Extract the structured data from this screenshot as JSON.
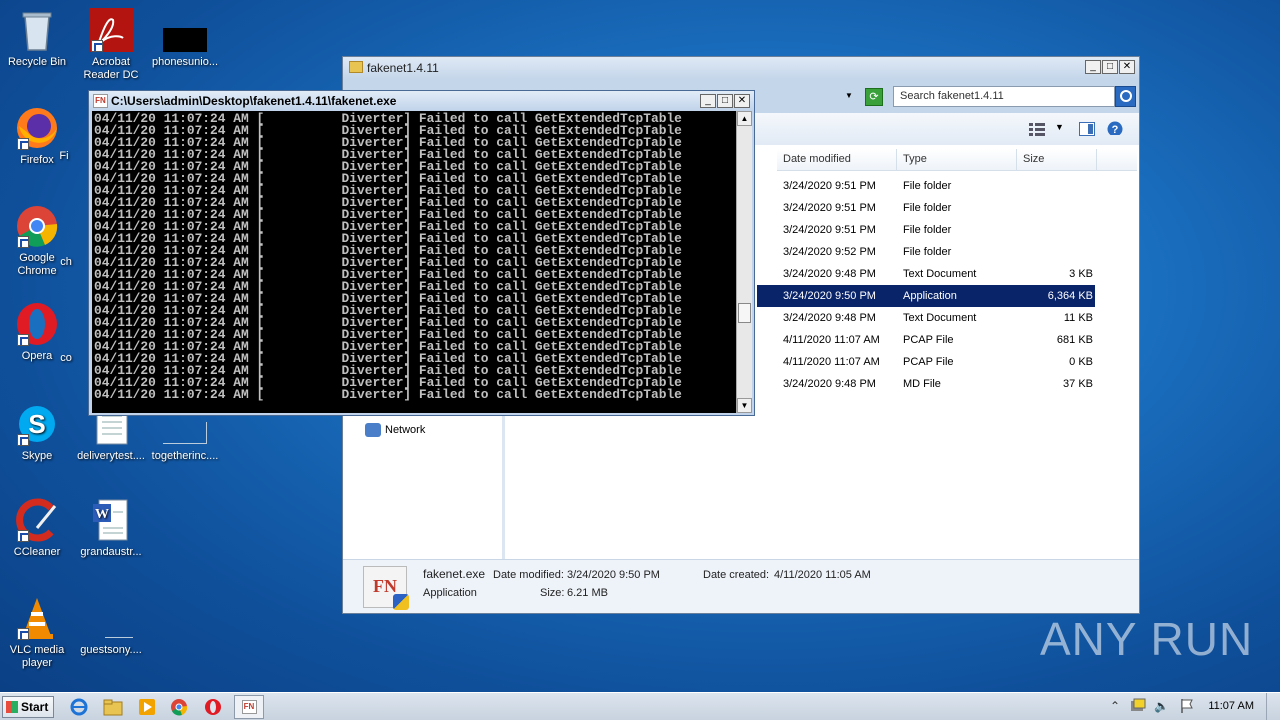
{
  "desktop_icons": [
    {
      "label": "Recycle Bin",
      "icon": "recycle-bin-icon"
    },
    {
      "label": "Acrobat Reader DC",
      "icon": "acrobat-icon"
    },
    {
      "label": "phonesunio...",
      "icon": "file-icon"
    },
    {
      "label": "Firefox",
      "icon": "firefox-icon"
    },
    {
      "label": "Fi",
      "icon": "file-icon"
    },
    {
      "label": "Google Chrome",
      "icon": "chrome-icon"
    },
    {
      "label": "ch",
      "icon": "file-icon"
    },
    {
      "label": "Opera",
      "icon": "opera-icon"
    },
    {
      "label": "co",
      "icon": "file-icon"
    },
    {
      "label": "Skype",
      "icon": "skype-icon"
    },
    {
      "label": "deliverytest....",
      "icon": "word-doc-icon"
    },
    {
      "label": "togetherinc....",
      "icon": "file-icon"
    },
    {
      "label": "CCleaner",
      "icon": "ccleaner-icon"
    },
    {
      "label": "grandaustr...",
      "icon": "word-doc-icon"
    },
    {
      "label": "VLC media player",
      "icon": "vlc-icon"
    },
    {
      "label": "guestsony....",
      "icon": "file-icon"
    }
  ],
  "explorer": {
    "title": "fakenet1.4.11",
    "search_placeholder": "Search fakenet1.4.11",
    "columns": [
      "Date modified",
      "Type",
      "Size"
    ],
    "rows": [
      {
        "date": "3/24/2020 9:51 PM",
        "type": "File folder",
        "size": ""
      },
      {
        "date": "3/24/2020 9:51 PM",
        "type": "File folder",
        "size": ""
      },
      {
        "date": "3/24/2020 9:51 PM",
        "type": "File folder",
        "size": ""
      },
      {
        "date": "3/24/2020 9:52 PM",
        "type": "File folder",
        "size": ""
      },
      {
        "date": "3/24/2020 9:48 PM",
        "type": "Text Document",
        "size": "3 KB"
      },
      {
        "date": "3/24/2020 9:50 PM",
        "type": "Application",
        "size": "6,364 KB"
      },
      {
        "date": "3/24/2020 9:48 PM",
        "type": "Text Document",
        "size": "11 KB"
      },
      {
        "date": "4/11/2020 11:07 AM",
        "type": "PCAP File",
        "size": "681 KB"
      },
      {
        "date": "4/11/2020 11:07 AM",
        "type": "PCAP File",
        "size": "0 KB"
      },
      {
        "date": "3/24/2020 9:48 PM",
        "type": "MD File",
        "size": "37 KB"
      }
    ],
    "nav_network": "Network",
    "details": {
      "filename": "fakenet.exe",
      "date_modified_label": "Date modified:",
      "date_modified": "3/24/2020 9:50 PM",
      "date_created_label": "Date created:",
      "date_created": "4/11/2020 11:05 AM",
      "type": "Application",
      "size_label": "Size:",
      "size": "6.21 MB"
    }
  },
  "console": {
    "title": "C:\\Users\\admin\\Desktop\\fakenet1.4.11\\fakenet.exe",
    "line": "04/11/20 11:07:24 AM [          Diverter] Failed to call GetExtendedTcpTable",
    "line_count": 24
  },
  "taskbar": {
    "start_label": "Start",
    "clock": "11:07 AM"
  },
  "watermark": "ANY RUN"
}
